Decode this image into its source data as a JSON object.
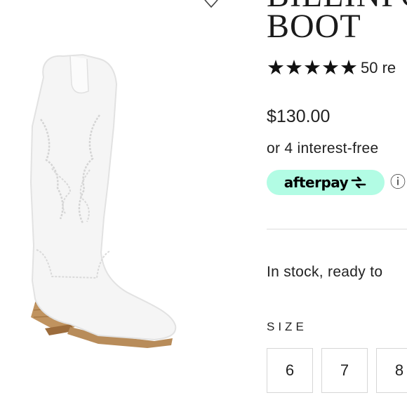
{
  "product": {
    "title_line1": "BILLINFO",
    "title_line2": "BOOT",
    "stars": "★★★★★",
    "review_count": "50 re",
    "price": "$130.00",
    "installments": "or 4 interest-free",
    "afterpay_label": "afterpay",
    "info_glyph": "ⓘ",
    "stock": "In stock, ready to",
    "size_label": "SIZE",
    "sizes": [
      "6",
      "7",
      "8"
    ]
  },
  "icons": {
    "wishlist": "heart-icon",
    "afterpay": "afterpay-arrow-icon",
    "info": "info-icon"
  },
  "colors": {
    "afterpay_mint": "#b2fce4",
    "text": "#222222",
    "border": "#d6d6d6"
  }
}
